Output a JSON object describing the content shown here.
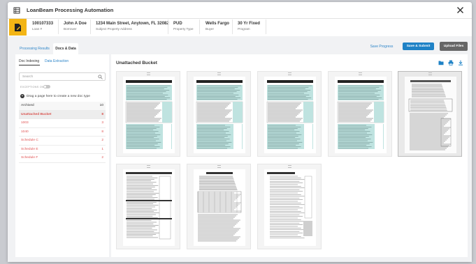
{
  "app": {
    "title": "LoanBeam Processing Automation"
  },
  "loan": [
    {
      "value": "100107333",
      "label": "Loan #"
    },
    {
      "value": "John A Doe",
      "label": "Borrower"
    },
    {
      "value": "1234 Main Street, Anytown, FL 32082",
      "label": "Subject Property Address"
    },
    {
      "value": "PUD",
      "label": "Property Type"
    },
    {
      "value": "Wells Fargo",
      "label": "Buyer"
    },
    {
      "value": "30 Yr Fixed",
      "label": "Program"
    }
  ],
  "tabs": [
    "Processing Results",
    "Docs & Data"
  ],
  "actions": {
    "save": "Save Progress",
    "submit": "Save & Submit",
    "upload": "Upload Files"
  },
  "left": {
    "tabs": [
      "Doc Indexing",
      "Data Extraction"
    ],
    "search_placeholder": "Search",
    "exceptions_label": "EXCEPTIONS ONLY",
    "drag_hint": "Drag a page here to create a new doc type",
    "drag_icon": "+",
    "list": [
      {
        "name": "Archived",
        "count": "10"
      },
      {
        "name": "Unattached Bucket",
        "count": "8"
      },
      {
        "name": "1003",
        "count": "3"
      },
      {
        "name": "1040",
        "count": "8"
      },
      {
        "name": "Schedule C",
        "count": "2"
      },
      {
        "name": "Schedule E",
        "count": "1"
      },
      {
        "name": "Schedule F",
        "count": "2"
      }
    ]
  },
  "main": {
    "title": "Unattached Bucket"
  },
  "icons": [
    "grid-icon",
    "folder-icon",
    "print-icon",
    "download-icon",
    "close-icon",
    "search-icon",
    "document-edit-icon"
  ],
  "colors": {
    "accent": "#1f82c6",
    "link": "#2f86c9",
    "warning": "#f3b515",
    "danger": "#e05252",
    "form_teal": "#bfe3e0"
  }
}
